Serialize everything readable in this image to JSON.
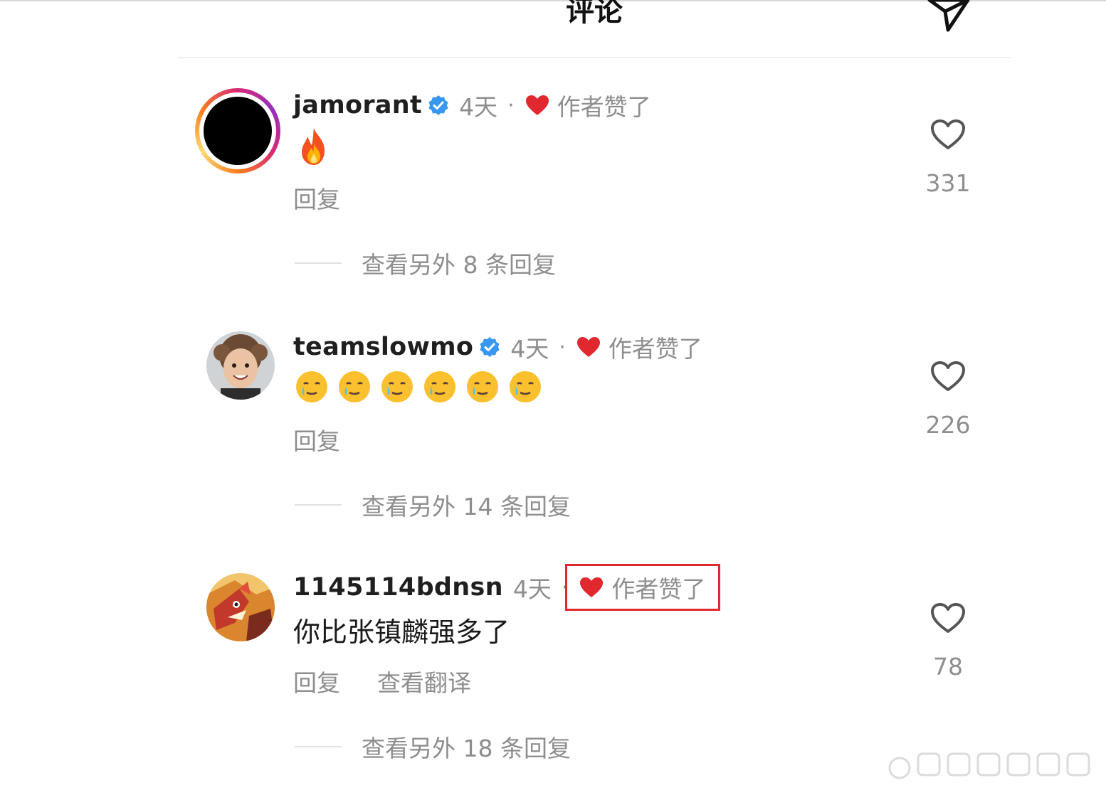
{
  "header": {
    "title": "评论",
    "share_icon": "share-send-icon"
  },
  "colors": {
    "accent_red": "#e0282e",
    "verified_blue": "#3897f0",
    "muted_text": "#8e8e8e",
    "highlight_border": "#e0282e"
  },
  "comments": [
    {
      "username": "jamorant",
      "verified": true,
      "time": "4天",
      "separator": "·",
      "author_liked": "作者赞了",
      "body_emoji": "fire",
      "actions": [
        "回复"
      ],
      "view_replies": "查看另外 8 条回复",
      "likes": "331"
    },
    {
      "username": "teamslowmo",
      "verified": true,
      "time": "4天",
      "separator": "·",
      "author_liked": "作者赞了",
      "body_emoji": "smiling-face-with-tear x6",
      "actions": [
        "回复"
      ],
      "view_replies": "查看另外 14 条回复",
      "likes": "226"
    },
    {
      "username": "1145114bdnsn",
      "verified": false,
      "time": "4天",
      "separator": "·",
      "author_liked": "作者赞了",
      "body": "你比张镇麟强多了",
      "actions": [
        "回复",
        "查看翻译"
      ],
      "view_replies": "查看另外 18 条回复",
      "likes": "78"
    }
  ]
}
